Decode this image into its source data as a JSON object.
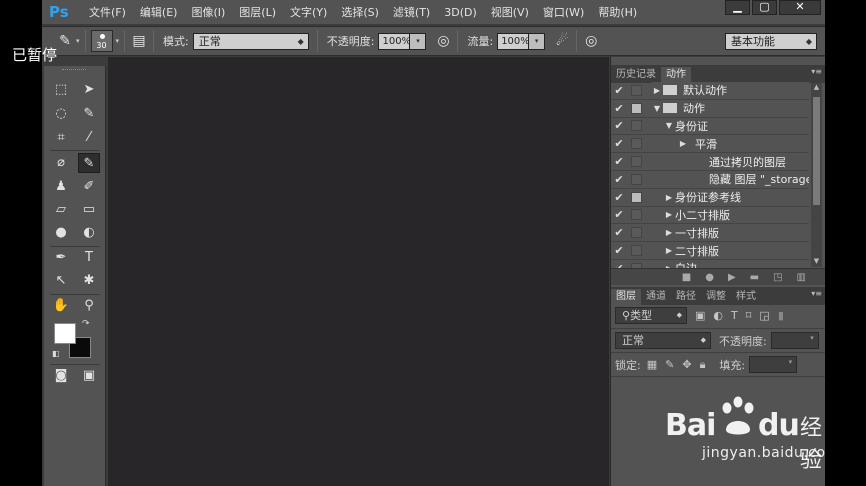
{
  "overlay": {
    "paused": "已暂停"
  },
  "app": {
    "logo": "Ps"
  },
  "menu": [
    {
      "label": "文件(F)"
    },
    {
      "label": "编辑(E)"
    },
    {
      "label": "图像(I)"
    },
    {
      "label": "图层(L)"
    },
    {
      "label": "文字(Y)"
    },
    {
      "label": "选择(S)"
    },
    {
      "label": "滤镜(T)"
    },
    {
      "label": "3D(D)"
    },
    {
      "label": "视图(V)"
    },
    {
      "label": "窗口(W)"
    },
    {
      "label": "帮助(H)"
    }
  ],
  "window_buttons": {
    "minimize": "▁",
    "restore": "▢",
    "close": "✕"
  },
  "options": {
    "brush_size": "30",
    "mode_label": "模式:",
    "mode_value": "正常",
    "opacity_label": "不透明度:",
    "opacity_value": "100%",
    "flow_label": "流量:",
    "flow_value": "100%",
    "workspace": "基本功能"
  },
  "tools": [
    {
      "name": "rectangular-marquee-icon",
      "glyph": "⬚"
    },
    {
      "name": "move-icon",
      "glyph": "✥"
    },
    {
      "name": "lasso-icon",
      "glyph": "◌"
    },
    {
      "name": "quick-selection-icon",
      "glyph": "✎"
    },
    {
      "name": "crop-icon",
      "glyph": "⌗"
    },
    {
      "name": "eyedropper-icon",
      "glyph": "⁄"
    },
    {
      "name": "healing-brush-icon",
      "glyph": "⌀"
    },
    {
      "name": "brush-icon",
      "glyph": "✎"
    },
    {
      "name": "clone-stamp-icon",
      "glyph": "♟"
    },
    {
      "name": "history-brush-icon",
      "glyph": "✐"
    },
    {
      "name": "eraser-icon",
      "glyph": "▱"
    },
    {
      "name": "gradient-icon",
      "glyph": "▭"
    },
    {
      "name": "blur-icon",
      "glyph": "●"
    },
    {
      "name": "dodge-icon",
      "glyph": "◐"
    },
    {
      "name": "pen-icon",
      "glyph": "✒"
    },
    {
      "name": "type-icon",
      "glyph": "T"
    },
    {
      "name": "path-selection-icon",
      "glyph": "↖"
    },
    {
      "name": "custom-shape-icon",
      "glyph": "✱"
    },
    {
      "name": "hand-icon",
      "glyph": "✋"
    },
    {
      "name": "zoom-icon",
      "glyph": "⚲"
    },
    {
      "name": "quick-mask-icon",
      "glyph": "◙"
    },
    {
      "name": "screen-mode-icon",
      "glyph": "▣"
    }
  ],
  "panels": {
    "actions_tabs": [
      "历史记录",
      "动作"
    ],
    "actions": [
      {
        "indent": 0,
        "expanded": false,
        "folder": true,
        "name": "默认动作",
        "filled": false
      },
      {
        "indent": 0,
        "expanded": true,
        "folder": true,
        "name": "动作",
        "filled": true
      },
      {
        "indent": 1,
        "expanded": true,
        "folder": false,
        "name": "身份证",
        "filled": false
      },
      {
        "indent": 2,
        "expanded": false,
        "folder": false,
        "name": "平滑",
        "filled": false
      },
      {
        "indent": 3,
        "expanded": null,
        "folder": false,
        "name": "通过拷贝的图层",
        "filled": false
      },
      {
        "indent": 3,
        "expanded": null,
        "folder": false,
        "name": "隐藏 图层 \"_storage_...",
        "filled": false
      },
      {
        "indent": 1,
        "expanded": false,
        "folder": false,
        "name": "身份证参考线",
        "filled": true
      },
      {
        "indent": 1,
        "expanded": false,
        "folder": false,
        "name": "小二寸排版",
        "filled": false
      },
      {
        "indent": 1,
        "expanded": false,
        "folder": false,
        "name": "一寸排版",
        "filled": false
      },
      {
        "indent": 1,
        "expanded": false,
        "folder": false,
        "name": "二寸排版",
        "filled": false
      },
      {
        "indent": 1,
        "expanded": false,
        "folder": false,
        "name": "白边",
        "filled": false
      }
    ],
    "layers_tabs": [
      "图层",
      "通道",
      "路径",
      "调整",
      "样式"
    ],
    "layers": {
      "filter_kind": "类型",
      "blend_mode": "正常",
      "opacity_label": "不透明度:",
      "lock_label": "锁定:",
      "fill_label": "填充:"
    }
  },
  "watermark": {
    "brand_left": "Bai",
    "brand_right": "du",
    "suffix": "经验",
    "url": "jingyan.baidu.com"
  }
}
